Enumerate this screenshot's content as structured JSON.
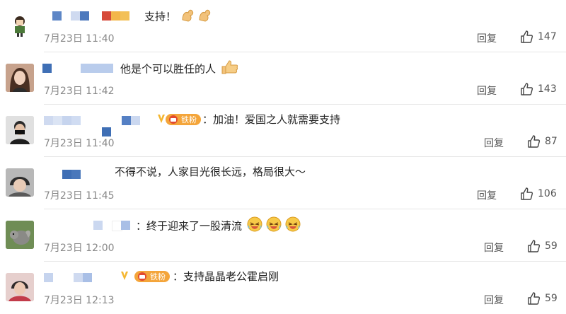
{
  "comments": [
    {
      "text": "支持！",
      "time": "7月23日 11:40",
      "reply": "回复",
      "likes": "147"
    },
    {
      "text": "他是个可以胜任的人",
      "time": "7月23日 11:42",
      "reply": "回复",
      "likes": "143"
    },
    {
      "text": "：加油！爱国之人就需要支持",
      "time": "7月23日 11:40",
      "reply": "回复",
      "likes": "87",
      "badge": "铁粉"
    },
    {
      "text": "不得不说，人家目光很长远，格局很大～",
      "time": "7月23日 11:45",
      "reply": "回复",
      "likes": "106"
    },
    {
      "text": "：终于迎来了一股清流",
      "time": "7月23日 12:00",
      "reply": "回复",
      "likes": "59"
    },
    {
      "text": "：支持晶晶老公霍启刚",
      "time": "7月23日 12:13",
      "reply": "回复",
      "likes": "59",
      "badge": "铁粉"
    }
  ],
  "colors": {
    "time": "#888888",
    "action": "#555555",
    "fan_badge": "#f4a53a",
    "blur_blue": "#3b6fb5"
  }
}
